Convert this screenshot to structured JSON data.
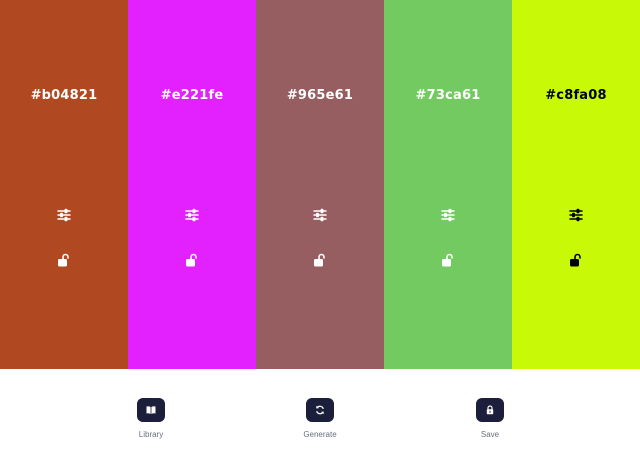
{
  "palette": {
    "colors": [
      {
        "hex": "#b04821",
        "text_color": "#ffffff",
        "adjust_icon": "sliders-icon",
        "lock_icon": "unlocked-padlock-icon"
      },
      {
        "hex": "#e221fe",
        "text_color": "#ffffff",
        "adjust_icon": "sliders-icon",
        "lock_icon": "unlocked-padlock-icon"
      },
      {
        "hex": "#965e61",
        "text_color": "#ffffff",
        "adjust_icon": "sliders-icon",
        "lock_icon": "unlocked-padlock-icon"
      },
      {
        "hex": "#73ca61",
        "text_color": "#ffffff",
        "adjust_icon": "sliders-icon",
        "lock_icon": "unlocked-padlock-icon"
      },
      {
        "hex": "#c8fa08",
        "text_color": "#000000",
        "adjust_icon": "sliders-icon",
        "lock_icon": "unlocked-padlock-icon"
      }
    ]
  },
  "toolbar": {
    "button_color": "#1b1f3b",
    "library": {
      "label": "Library",
      "icon": "book-icon"
    },
    "generate": {
      "label": "Generate",
      "icon": "refresh-icon"
    },
    "save": {
      "label": "Save",
      "icon": "lock-icon"
    }
  }
}
